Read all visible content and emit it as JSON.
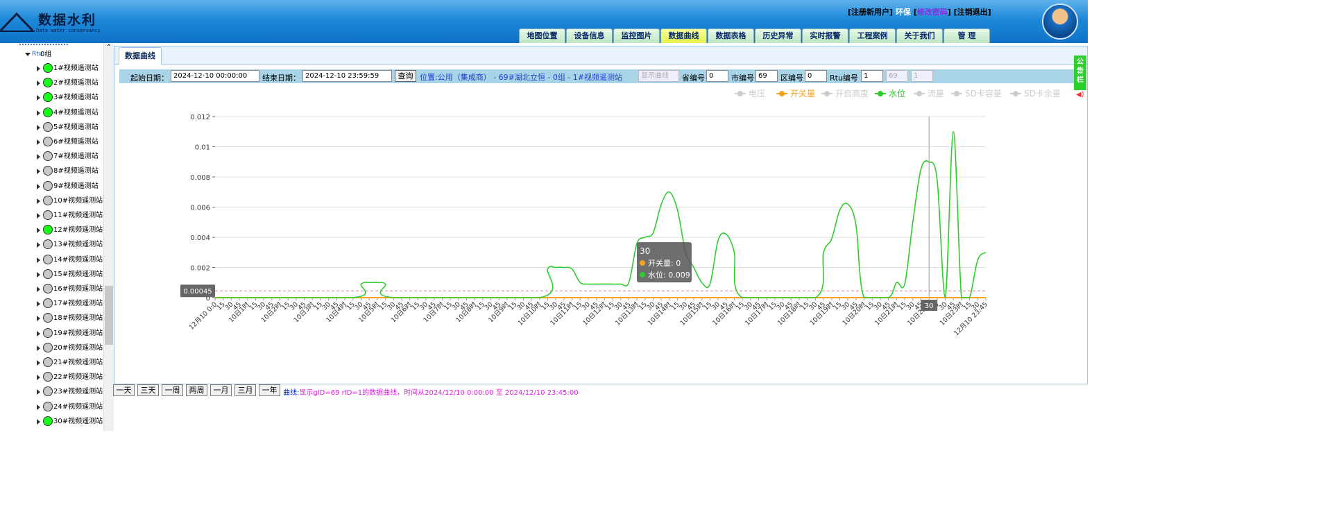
{
  "header": {
    "logo_title": "数据水利",
    "logo_subtitle": "Data water conservancy",
    "links": {
      "register": "[注册新用户]",
      "user": "环保",
      "change_pw": "修改密码",
      "logout": "[注销退出]",
      "bracket_open": "[",
      "bracket_close": "]"
    },
    "nav": [
      "地图位置",
      "设备信息",
      "监控图片",
      "数据曲线",
      "数据表格",
      "历史异常",
      "实时报警",
      "工程案例",
      "关于我们",
      "管 理"
    ],
    "nav_active": "数据曲线"
  },
  "sidebar": {
    "group_label": "0组",
    "group_icon_text": "Rtu",
    "stations": [
      {
        "label": "1#视频遥测站",
        "online": true
      },
      {
        "label": "2#视频遥测站",
        "online": true
      },
      {
        "label": "3#视频遥测站",
        "online": true
      },
      {
        "label": "4#视频遥测站",
        "online": true
      },
      {
        "label": "5#视频遥测站",
        "online": false
      },
      {
        "label": "6#视频遥测站",
        "online": false
      },
      {
        "label": "7#视频遥测站",
        "online": false
      },
      {
        "label": "8#视频遥测站",
        "online": false
      },
      {
        "label": "9#视频遥测站",
        "online": false
      },
      {
        "label": "10#视频遥测站",
        "online": false
      },
      {
        "label": "11#视频遥测站",
        "online": false
      },
      {
        "label": "12#视频遥测站",
        "online": true
      },
      {
        "label": "13#视频遥测站",
        "online": false
      },
      {
        "label": "14#视频遥测站",
        "online": false
      },
      {
        "label": "15#视频遥测站",
        "online": false
      },
      {
        "label": "16#视频遥测站",
        "online": false
      },
      {
        "label": "17#视频遥测站",
        "online": false
      },
      {
        "label": "18#视频遥测站",
        "online": false
      },
      {
        "label": "19#视频遥测站",
        "online": false
      },
      {
        "label": "20#视频遥测站",
        "online": false
      },
      {
        "label": "21#视频遥测站",
        "online": false
      },
      {
        "label": "22#视频遥测站",
        "online": false
      },
      {
        "label": "23#视频遥测站",
        "online": false
      },
      {
        "label": "24#视频遥测站",
        "online": false
      },
      {
        "label": "30#视频遥测站",
        "online": true
      }
    ]
  },
  "panel": {
    "tab_label": "数据曲线"
  },
  "query": {
    "start_label": "起始日期：",
    "start_value": "2024-12-10 00:00:00",
    "end_label": "结束日期：",
    "end_value": "2024-12-10 23:59:59",
    "query_button": "查询",
    "location": "位置:公用（集成商） - 69#湖北立恒 - 0组 - 1#视频遥测站",
    "show_curve": "显示曲线",
    "province_label": "省编号",
    "province_value": "0",
    "city_label": "市编号",
    "city_value": "69",
    "district_label": "区编号",
    "district_value": "0",
    "rtu_label": "Rtu编号",
    "rtu_value": "1",
    "extra1": "69",
    "extra2": "1"
  },
  "tooltip": {
    "title": "30",
    "line1": "开关量: 0",
    "line2": "水位: 0.009",
    "plotline_label": "0.00045",
    "crosshair_label": "30"
  },
  "chart_data": {
    "type": "line",
    "legend": [
      {
        "name": "电压",
        "enabled": false,
        "color": "#cccccc"
      },
      {
        "name": "开关量",
        "enabled": true,
        "color": "#f7a21b"
      },
      {
        "name": "开启高度",
        "enabled": false,
        "color": "#cccccc"
      },
      {
        "name": "水位",
        "enabled": true,
        "color": "#2ecc2e"
      },
      {
        "name": "流量",
        "enabled": false,
        "color": "#cccccc"
      },
      {
        "name": "SD卡容量",
        "enabled": false,
        "color": "#cccccc"
      },
      {
        "name": "SD卡余量",
        "enabled": false,
        "color": "#cccccc"
      }
    ],
    "y_ticks": [
      "0",
      "0.002",
      "0.004",
      "0.006",
      "0.008",
      "0.01",
      "0.012"
    ],
    "ylim": [
      0,
      0.012
    ],
    "x_range_minutes": [
      0,
      1425
    ],
    "x_labels": [
      "12月10 0:0",
      "15",
      "30",
      "45",
      "10日1时",
      "15",
      "30",
      "45",
      "10日2时",
      "15",
      "30",
      "45",
      "10日3时",
      "15",
      "30",
      "45",
      "10日4时",
      "15",
      "30",
      "45",
      "10日5时",
      "15",
      "30",
      "45",
      "10日6时",
      "15",
      "30",
      "45",
      "10日7时",
      "15",
      "30",
      "45",
      "10日8时",
      "15",
      "30",
      "45",
      "10日9时",
      "15",
      "30",
      "45",
      "10日10时",
      "15",
      "30",
      "45",
      "10日11时",
      "15",
      "30",
      "45",
      "10日12时",
      "15",
      "30",
      "45",
      "10日13时",
      "15",
      "30",
      "45",
      "10日14时",
      "15",
      "30",
      "45",
      "10日15时",
      "15",
      "30",
      "45",
      "10日16时",
      "15",
      "30",
      "45",
      "10日17时",
      "15",
      "30",
      "45",
      "10日18时",
      "15",
      "30",
      "45",
      "10日19时",
      "15",
      "30",
      "45",
      "10日20时",
      "15",
      "30",
      "45",
      "10日21时",
      "15",
      "30",
      "45",
      "10日22时",
      "15",
      "30",
      "45",
      "10日23时",
      "15",
      "30",
      "12月10 23:45"
    ],
    "plot_line_value": 0.00045,
    "series": [
      {
        "name": "水位",
        "color": "#2ecc2e",
        "points": [
          [
            0,
            0
          ],
          [
            255,
            0
          ],
          [
            270,
            0.0009
          ],
          [
            285,
            0.001
          ],
          [
            300,
            0.001
          ],
          [
            315,
            0.0009
          ],
          [
            330,
            0
          ],
          [
            600,
            0
          ],
          [
            615,
            0.0019
          ],
          [
            630,
            0.002
          ],
          [
            645,
            0.002
          ],
          [
            660,
            0.0019
          ],
          [
            675,
            0.001
          ],
          [
            690,
            0.0009
          ],
          [
            705,
            0.0009
          ],
          [
            720,
            0.0009
          ],
          [
            735,
            0.0009
          ],
          [
            750,
            0.0009
          ],
          [
            765,
            0.001
          ],
          [
            780,
            0.0036
          ],
          [
            795,
            0.004
          ],
          [
            810,
            0.0043
          ],
          [
            825,
            0.0062
          ],
          [
            840,
            0.007
          ],
          [
            855,
            0.0058
          ],
          [
            870,
            0.003
          ],
          [
            885,
            0.002
          ],
          [
            900,
            0.001
          ],
          [
            915,
            0.0009
          ],
          [
            930,
            0.0038
          ],
          [
            945,
            0.0042
          ],
          [
            960,
            0.003
          ],
          [
            975,
            0
          ],
          [
            1110,
            0
          ],
          [
            1125,
            0.003
          ],
          [
            1140,
            0.0039
          ],
          [
            1155,
            0.0058
          ],
          [
            1170,
            0.0062
          ],
          [
            1185,
            0.0048
          ],
          [
            1200,
            0
          ],
          [
            1245,
            0
          ],
          [
            1260,
            0.001
          ],
          [
            1275,
            0.0009
          ],
          [
            1290,
            0.005
          ],
          [
            1305,
            0.0085
          ],
          [
            1320,
            0.009
          ],
          [
            1335,
            0.0078
          ],
          [
            1350,
            0
          ],
          [
            1365,
            0.011
          ],
          [
            1380,
            0
          ],
          [
            1395,
            0
          ],
          [
            1410,
            0.0025
          ],
          [
            1425,
            0.003
          ]
        ]
      },
      {
        "name": "开关量",
        "color": "#f7a21b",
        "points": [
          [
            0,
            0
          ],
          [
            1425,
            0
          ]
        ]
      }
    ]
  },
  "bottom": {
    "buttons": [
      "一天",
      "三天",
      "一周",
      "两周",
      "一月",
      "三月",
      "一年"
    ],
    "info_label": "曲线:",
    "info_text": "显示gID=69 rID=1的数据曲线，时间从2024/12/10 0:00:00 至 2024/12/10 23:45:00"
  },
  "notice": {
    "text": "公告栏"
  }
}
